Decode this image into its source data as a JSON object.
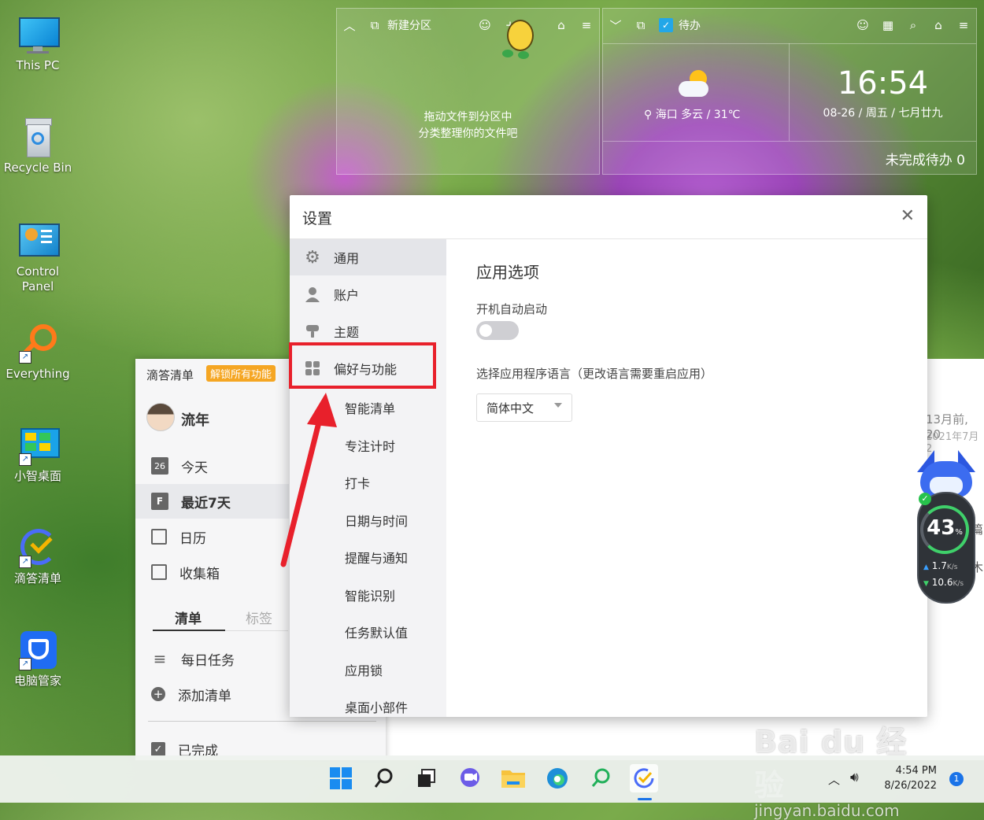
{
  "desktop": {
    "icons": [
      {
        "label": "This PC"
      },
      {
        "label": "Recycle Bin"
      },
      {
        "label": "Control\nPanel"
      },
      {
        "label": "Everything"
      },
      {
        "label": "小智桌面"
      },
      {
        "label": "滴答清单"
      },
      {
        "label": "电脑管家"
      }
    ]
  },
  "partition_widget": {
    "title": "新建分区",
    "hint_line1": "拖动文件到分区中",
    "hint_line2": "分类整理你的文件吧"
  },
  "todo_widget": {
    "title": "待办",
    "weather": "海口 多云 / 31℃",
    "time": "16:54",
    "date": "08-26 / 周五 / 七月廿九",
    "pending": "未完成待办 0"
  },
  "ticktick": {
    "app_name": "滴答清单",
    "unlock_badge": "解锁所有功能",
    "username": "流年",
    "today_num": "26",
    "nav": [
      {
        "label": "今天"
      },
      {
        "label": "最近7天"
      },
      {
        "label": "日历"
      },
      {
        "label": "收集箱"
      }
    ],
    "tabs": [
      "清单",
      "标签"
    ],
    "lists": [
      {
        "label": "每日任务"
      },
      {
        "label": "添加清单"
      }
    ],
    "completed": "已完成",
    "bg_text1": "13月前, 20",
    "bg_text2": "2021年7月2",
    "bg_text3": "篇",
    "bg_text4": "木"
  },
  "settings": {
    "title": "设置",
    "sidebar": [
      {
        "label": "通用"
      },
      {
        "label": "账户"
      },
      {
        "label": "主题"
      },
      {
        "label": "偏好与功能"
      }
    ],
    "subitems": [
      {
        "label": "智能清单"
      },
      {
        "label": "专注计时"
      },
      {
        "label": "打卡"
      },
      {
        "label": "日期与时间"
      },
      {
        "label": "提醒与通知"
      },
      {
        "label": "智能识别"
      },
      {
        "label": "任务默认值"
      },
      {
        "label": "应用锁"
      },
      {
        "label": "桌面小部件"
      }
    ],
    "section_title": "应用选项",
    "autostart_label": "开机自动启动",
    "autostart_on": false,
    "language_label": "选择应用程序语言（更改语言需要重启应用）",
    "language_value": "简体中文"
  },
  "net_monitor": {
    "percent": "43",
    "percent_unit": "%",
    "upload": "1.7",
    "upload_unit": "K/s",
    "download": "10.6",
    "download_unit": "K/s"
  },
  "taskbar": {
    "time": "4:54 PM",
    "date": "8/26/2022",
    "notification_count": "1"
  },
  "watermark": {
    "line1": "Bai du 经验",
    "line2": "jingyan.baidu.com"
  },
  "colors": {
    "highlight_red": "#e8202b",
    "unlock_orange": "#f5a623",
    "accent_blue": "#1a73e8"
  }
}
